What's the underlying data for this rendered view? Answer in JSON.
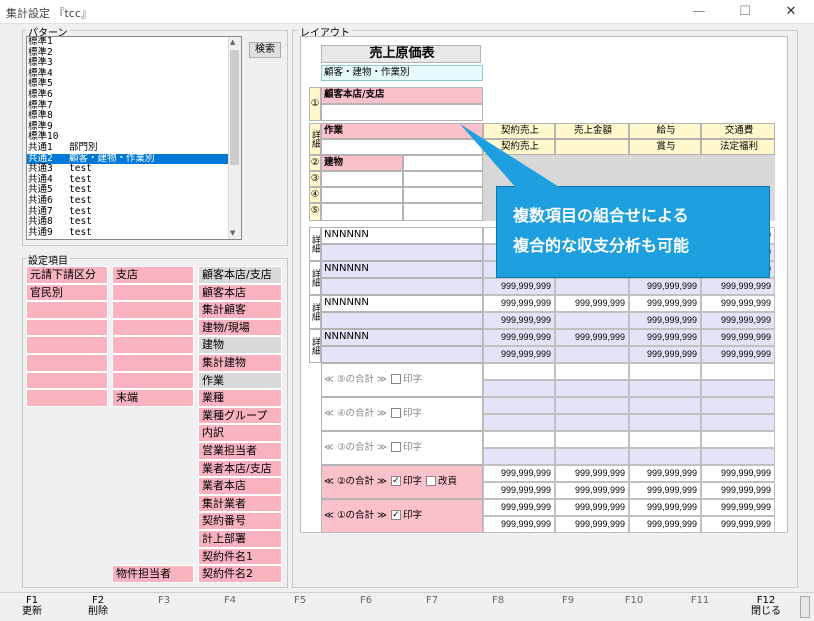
{
  "window": {
    "title": "集計設定 『tcc』"
  },
  "pattern": {
    "legend": "パターン",
    "search_label": "検索",
    "items": [
      {
        "code": "標準1",
        "name": ""
      },
      {
        "code": "標準2",
        "name": ""
      },
      {
        "code": "標準3",
        "name": ""
      },
      {
        "code": "標準4",
        "name": ""
      },
      {
        "code": "標準5",
        "name": ""
      },
      {
        "code": "標準6",
        "name": ""
      },
      {
        "code": "標準7",
        "name": ""
      },
      {
        "code": "標準8",
        "name": ""
      },
      {
        "code": "標準9",
        "name": ""
      },
      {
        "code": "標準10",
        "name": ""
      },
      {
        "code": "共通1",
        "name": "部門別"
      },
      {
        "code": "共通2",
        "name": "顧客・建物・作業別"
      },
      {
        "code": "共通3",
        "name": "test"
      },
      {
        "code": "共通4",
        "name": "test"
      },
      {
        "code": "共通5",
        "name": "test"
      },
      {
        "code": "共通6",
        "name": "test"
      },
      {
        "code": "共通7",
        "name": "test"
      },
      {
        "code": "共通8",
        "name": "test"
      },
      {
        "code": "共通9",
        "name": "test"
      }
    ],
    "selected_index": 11
  },
  "settings": {
    "legend": "設定項目",
    "col1": [
      "元請下請区分",
      "官民別",
      "",
      "",
      "",
      "",
      "",
      ""
    ],
    "col2": [
      "支店",
      "",
      "",
      "",
      "",
      "",
      "",
      "末端"
    ],
    "col2_bottom": "物件担当者",
    "col3": [
      "顧客本店/支店",
      "顧客本店",
      "集計顧客",
      "建物/現場",
      "建物",
      "集計建物",
      "作業",
      "業種",
      "業種グループ",
      "内訳",
      "営業担当者",
      "業者本店/支店",
      "業者本店",
      "集計業者",
      "契約番号",
      "計上部署",
      "契約件名1",
      "契約件名2"
    ],
    "col3_gray": [
      0,
      4,
      6
    ]
  },
  "layout": {
    "legend": "レイアウト",
    "title": "売上原価表",
    "subtitle": "顧客・建物・作業別",
    "circle1": "①",
    "kyaku": "顧客本店/支店",
    "shou": "詳細",
    "sagyou": "作業",
    "circle2": "②",
    "tatemono": "建物",
    "circle3": "③",
    "circle4": "④",
    "circle5": "⑤",
    "headers_r1": [
      "契約売上",
      "売上金額",
      "給与",
      "交通費"
    ],
    "headers_r2": [
      "契約売上",
      "",
      "賞与",
      "法定福利"
    ],
    "detail_label": "NNNNNN",
    "num": "999,999,999",
    "sum5": "≪ ⑤の合計 ≫",
    "sum4": "≪ ④の合計 ≫",
    "sum3": "≪ ③の合計 ≫",
    "sum2": "≪ ②の合計 ≫",
    "sum1": "≪ ①の合計 ≫",
    "print": "印字",
    "kaipage": "改頁"
  },
  "callout": {
    "line1": "複数項目の組合せによる",
    "line2": "複合的な収支分析も可能"
  },
  "fkeys": [
    {
      "k": "F1",
      "l": "更新"
    },
    {
      "k": "F2",
      "l": "削除"
    },
    {
      "k": "F3",
      "l": ""
    },
    {
      "k": "F4",
      "l": ""
    },
    {
      "k": "F5",
      "l": ""
    },
    {
      "k": "F6",
      "l": ""
    },
    {
      "k": "F7",
      "l": ""
    },
    {
      "k": "F8",
      "l": ""
    },
    {
      "k": "F9",
      "l": ""
    },
    {
      "k": "F10",
      "l": ""
    },
    {
      "k": "F11",
      "l": ""
    },
    {
      "k": "F12",
      "l": "閉じる"
    }
  ],
  "colors": {
    "pink": "#f9b3c0",
    "lavender": "#e4e4f8",
    "yellow": "#fff8cc",
    "callout": "#1ea0e0",
    "selection": "#0078d7"
  }
}
